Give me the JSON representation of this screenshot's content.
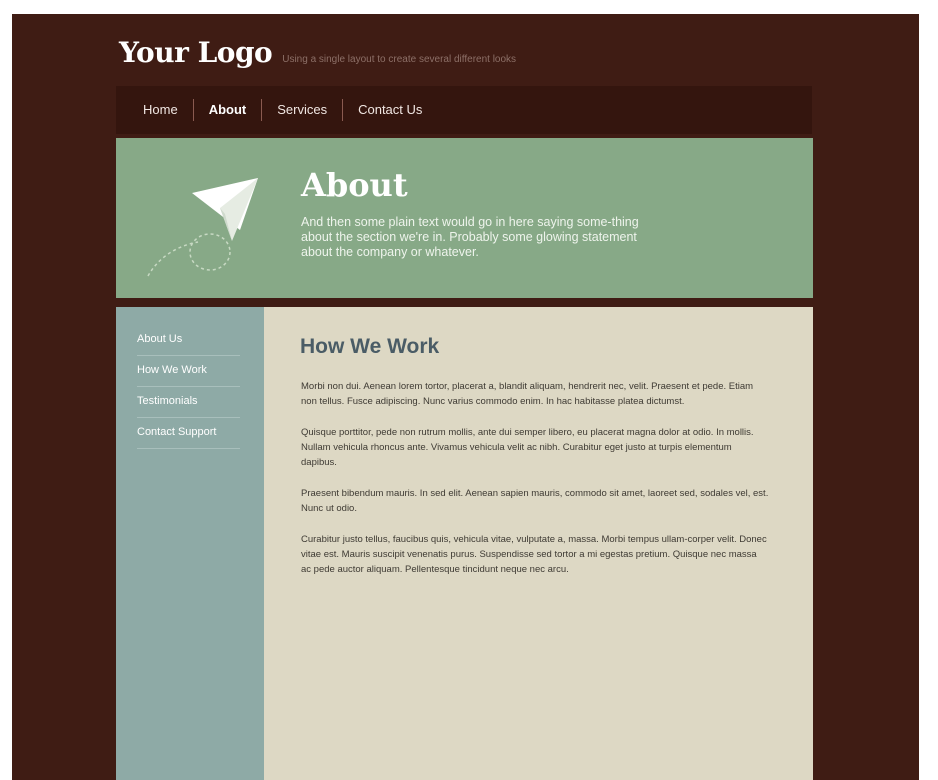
{
  "header": {
    "logo": "Your Logo",
    "tagline": "Using a single layout to create several different looks"
  },
  "nav": {
    "items": [
      {
        "label": "Home",
        "active": false
      },
      {
        "label": "About",
        "active": true
      },
      {
        "label": "Services",
        "active": false
      },
      {
        "label": "Contact Us",
        "active": false
      }
    ]
  },
  "hero": {
    "title": "About",
    "text": "And then some plain text would go in here saying some-thing about the section we're in.  Probably some glowing statement about the company or whatever.",
    "icon": "paper-plane-icon"
  },
  "sidebar": {
    "items": [
      {
        "label": "About Us"
      },
      {
        "label": "How We Work"
      },
      {
        "label": "Testimonials"
      },
      {
        "label": "Contact Support"
      }
    ]
  },
  "main": {
    "title": "How We Work",
    "paragraphs": [
      "Morbi non dui. Aenean lorem tortor, placerat a, blandit aliquam, hendrerit nec, velit. Praesent et pede. Etiam non tellus. Fusce adipiscing. Nunc varius commodo enim. In hac habitasse platea dictumst.",
      "Quisque porttitor, pede non rutrum mollis, ante dui semper libero, eu placerat magna dolor at odio. In mollis. Nullam vehicula rhoncus ante. Vivamus vehicula velit ac nibh. Curabitur eget justo at turpis elementum dapibus.",
      "Praesent bibendum mauris. In sed elit. Aenean sapien mauris, commodo sit amet, laoreet sed, sodales vel, est. Nunc ut odio.",
      "Curabitur justo tellus, faucibus quis, vehicula vitae, vulputate a, massa. Morbi tempus ullam-corper velit. Donec vitae est. Mauris suscipit venenatis purus. Suspendisse sed tortor a mi egestas pretium. Quisque nec massa ac pede auctor aliquam. Pellentesque tincidunt neque nec arcu."
    ]
  },
  "colors": {
    "page_bg": "#3f1c14",
    "nav_bg": "#34150e",
    "hero_bg": "#87a987",
    "sidebar_bg": "#8eaaa6",
    "content_bg": "#ddd8c4",
    "heading": "#4a5c66"
  }
}
